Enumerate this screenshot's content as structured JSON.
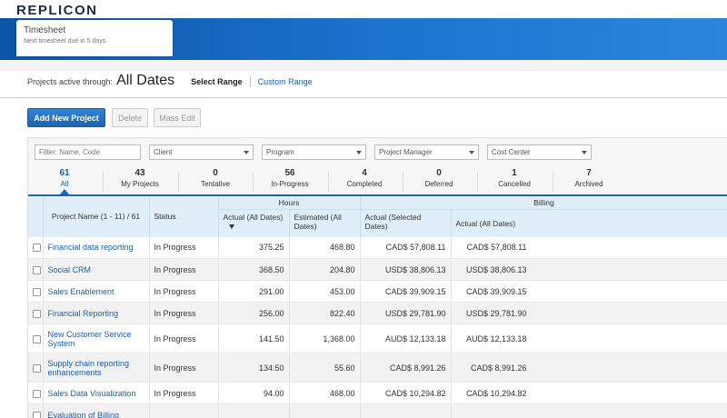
{
  "header": {
    "logo": "REPLICON",
    "tab_title": "Timesheet",
    "tab_subtitle": "Next timesheet due in 5 days"
  },
  "range": {
    "label": "Projects active through:",
    "value": "All Dates",
    "select_range": "Select Range",
    "custom_range": "Custom Range"
  },
  "toolbar": {
    "add_label": "Add New Project",
    "delete_label": "Delete",
    "mass_edit_label": "Mass Edit"
  },
  "filters": {
    "search_placeholder": "Filter: Name, Code",
    "client": "Client",
    "program": "Program",
    "project_manager": "Project Manager",
    "cost_center": "Cost Center"
  },
  "status_tabs": [
    {
      "count": "61",
      "label": "All"
    },
    {
      "count": "43",
      "label": "My Projects"
    },
    {
      "count": "0",
      "label": "Tentative"
    },
    {
      "count": "56",
      "label": "In-Progress"
    },
    {
      "count": "4",
      "label": "Completed"
    },
    {
      "count": "0",
      "label": "Deferred"
    },
    {
      "count": "1",
      "label": "Cancelled"
    },
    {
      "count": "7",
      "label": "Archived"
    }
  ],
  "table": {
    "group_hours": "Hours",
    "group_billing": "Billing",
    "col_project": "Project Name",
    "col_project_range": "(1 - 11) / 61",
    "col_status": "Status",
    "col_actual_hours": "Actual (All Dates)",
    "col_estimated_hours": "Estimated (All Dates)",
    "col_actual_selected": "Actual (Selected Dates)",
    "col_actual_all": "Actual (All Dates)",
    "rows": [
      {
        "name": "Financial data reporting",
        "status": "In Progress",
        "actual": "375.25",
        "estimated": "468.80",
        "billing_selected": "CAD$ 57,808.11",
        "billing_all": "CAD$ 57,808.11"
      },
      {
        "name": "Social CRM",
        "status": "In Progress",
        "actual": "368.50",
        "estimated": "204.80",
        "billing_selected": "USD$ 38,806.13",
        "billing_all": "USD$ 38,806.13"
      },
      {
        "name": "Sales Enablement",
        "status": "In Progress",
        "actual": "291.00",
        "estimated": "453.00",
        "billing_selected": "CAD$ 39,909.15",
        "billing_all": "CAD$ 39,909.15"
      },
      {
        "name": "Financial Reporting",
        "status": "In Progress",
        "actual": "256.00",
        "estimated": "822.40",
        "billing_selected": "USD$ 29,781.90",
        "billing_all": "USD$ 29,781.90"
      },
      {
        "name": "New Customer Service System",
        "status": "In Progress",
        "actual": "141.50",
        "estimated": "1,368.00",
        "billing_selected": "AUD$ 12,133.18",
        "billing_all": "AUD$ 12,133.18"
      },
      {
        "name": "Supply chain reporting enhancements",
        "status": "In Progress",
        "actual": "134.50",
        "estimated": "55.60",
        "billing_selected": "CAD$ 8,991.26",
        "billing_all": "CAD$ 8,991.26"
      },
      {
        "name": "Sales Data Visualization",
        "status": "In Progress",
        "actual": "94.00",
        "estimated": "468.00",
        "billing_selected": "CAD$ 10,294.82",
        "billing_all": "CAD$ 10,294.82"
      },
      {
        "name": "Evaluation of Billing",
        "status": "",
        "actual": "",
        "estimated": "",
        "billing_selected": "",
        "billing_all": ""
      }
    ]
  }
}
